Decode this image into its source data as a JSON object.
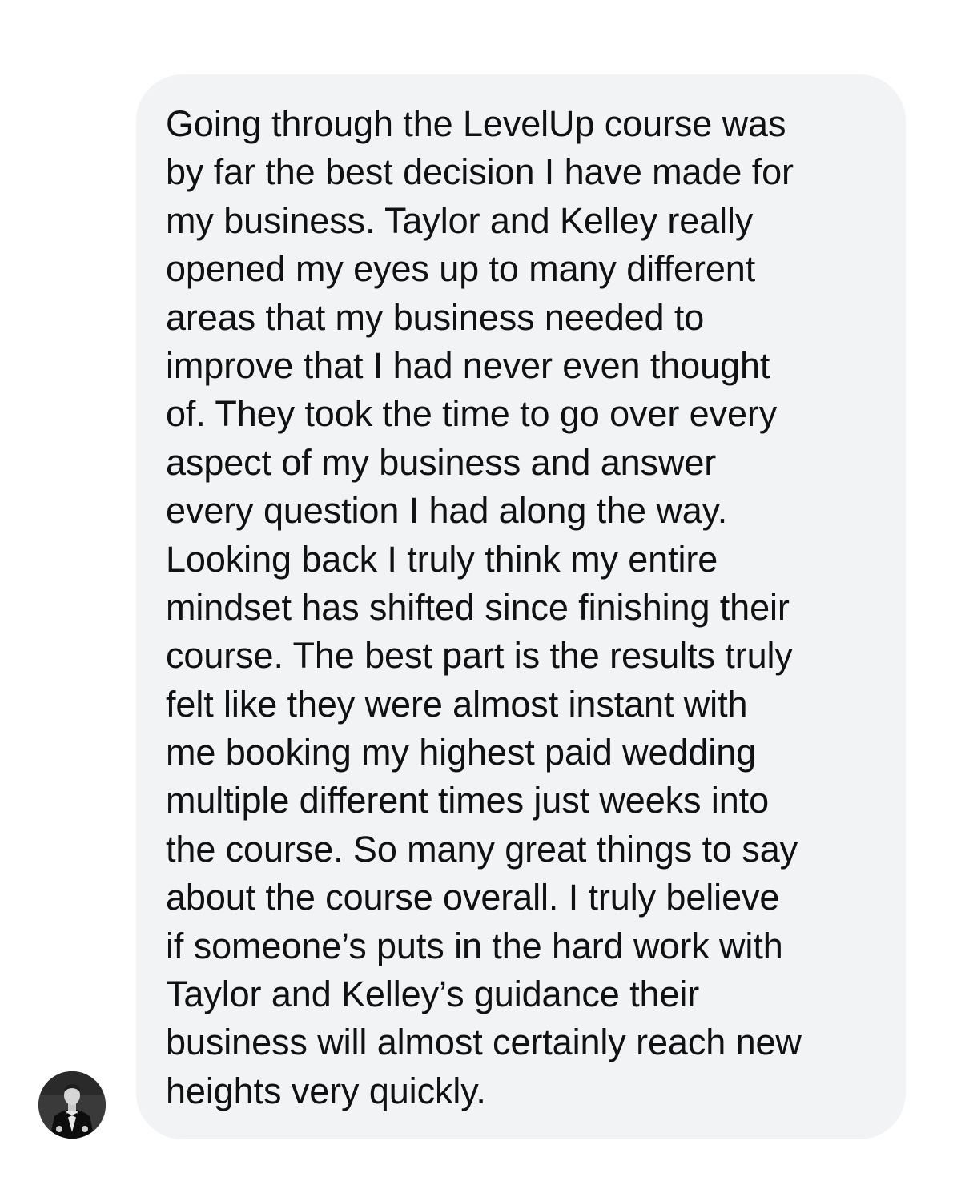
{
  "message": {
    "lines": [
      "Going through the LevelUp course was",
      "by far the best decision I have made for",
      "my business. Taylor and Kelley really",
      "opened my eyes up to many different",
      "areas that my business needed to",
      "improve that I had never even thought",
      "of. They took the time to go over every",
      "aspect of my business and answer",
      "every question I had along the way.",
      "Looking back I truly think my entire",
      "mindset has shifted since finishing their",
      "course. The best part is the results truly",
      "felt like they were almost instant with",
      "me booking my highest paid wedding",
      "multiple different times just weeks into",
      "the course. So many great things to say",
      "about the course overall. I truly believe",
      "if someone’s puts in the hard work with",
      "Taylor and Kelley’s guidance their",
      "business will almost certainly reach new",
      "heights very quickly."
    ]
  },
  "sender": {
    "avatar_icon": "profile-photo-icon"
  },
  "colors": {
    "bubble_background": "#f2f3f5",
    "text": "#111111",
    "page_background": "#ffffff"
  }
}
